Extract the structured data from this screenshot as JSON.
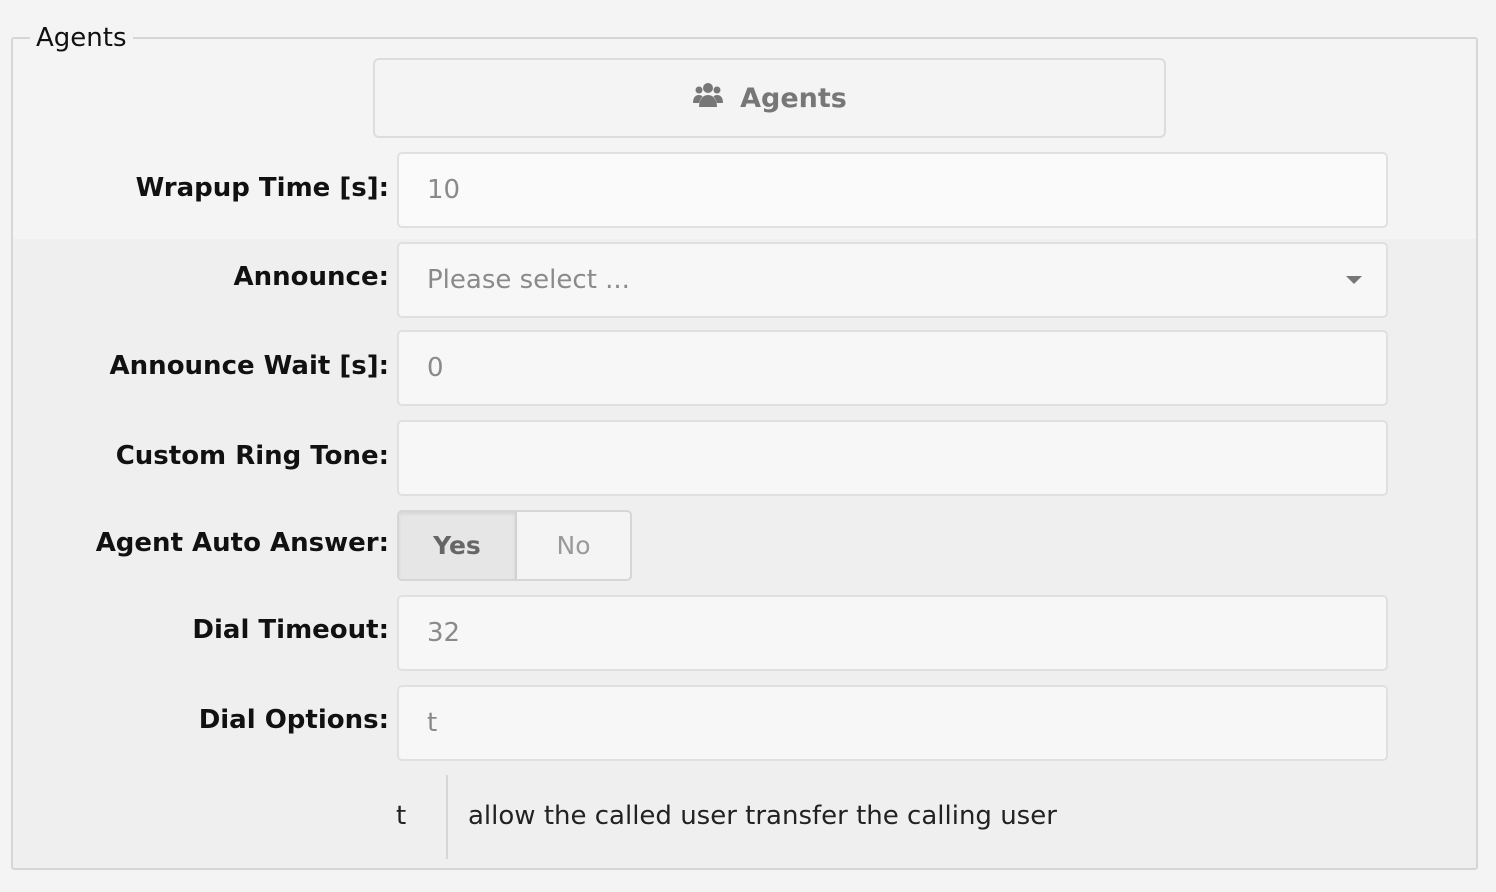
{
  "section": {
    "legend": "Agents",
    "agents_button_label": "Agents"
  },
  "fields": {
    "wrapup_time": {
      "label": "Wrapup Time [s]:",
      "value": "10"
    },
    "announce": {
      "label": "Announce:",
      "placeholder": "Please select ..."
    },
    "announce_wait": {
      "label": "Announce Wait [s]:",
      "value": "0"
    },
    "custom_ring_tone": {
      "label": "Custom Ring Tone:",
      "value": ""
    },
    "agent_auto_answer": {
      "label": "Agent Auto Answer:",
      "yes": "Yes",
      "no": "No",
      "selected": "Yes"
    },
    "dial_timeout": {
      "label": "Dial Timeout:",
      "value": "32"
    },
    "dial_options": {
      "label": "Dial Options:",
      "value": "t"
    }
  },
  "dial_options_help": {
    "key": "t",
    "description": "allow the called user transfer the calling user"
  },
  "icons": {
    "agents_button_icon": "users-icon",
    "announce_caret_icon": "caret-down-icon"
  },
  "colors": {
    "page_background": "#f4f4f4",
    "panel_background": "#efefef",
    "border": "#d6d6d6",
    "muted_text": "#777777"
  }
}
